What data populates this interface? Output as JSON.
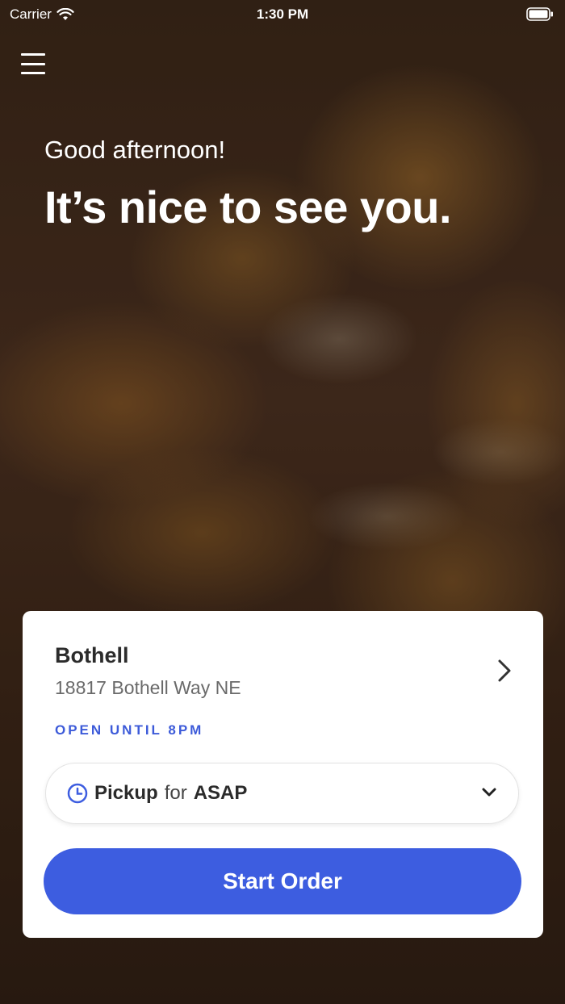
{
  "status_bar": {
    "carrier": "Carrier",
    "time": "1:30 PM"
  },
  "hero": {
    "greeting": "Good afternoon!",
    "headline": "It’s nice to see you."
  },
  "location": {
    "name": "Bothell",
    "address": "18817 Bothell Way NE",
    "hours": "OPEN UNTIL 8PM"
  },
  "order_mode": {
    "method": "Pickup",
    "connector": "for",
    "time": "ASAP"
  },
  "start_button_label": "Start Order",
  "colors": {
    "accent": "#3d5de0",
    "hours_text": "#3d5bd9"
  },
  "icons": [
    "wifi-icon",
    "battery-icon",
    "menu-icon",
    "chevron-right-icon",
    "clock-icon",
    "chevron-down-icon"
  ]
}
